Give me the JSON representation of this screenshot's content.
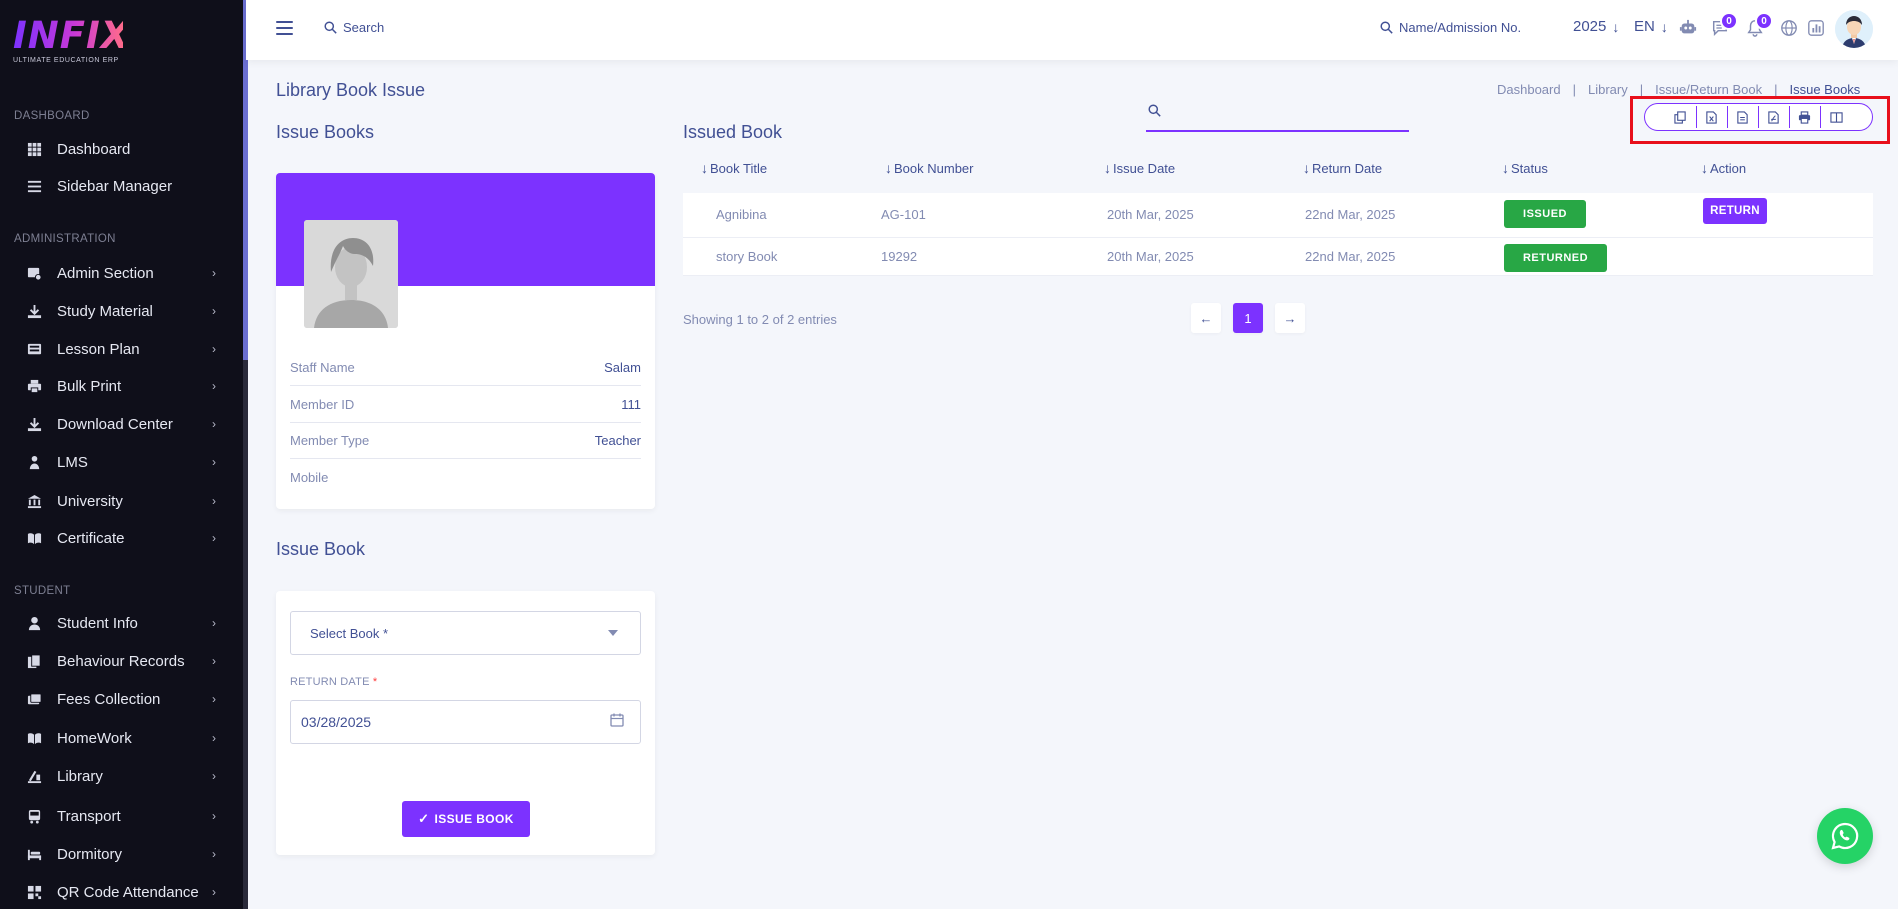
{
  "logo": {
    "word": "INFIX",
    "tagline": "ULTIMATE EDUCATION ERP"
  },
  "sidebar": {
    "sections": [
      {
        "title": "DASHBOARD",
        "items": [
          {
            "label": "Dashboard",
            "icon": "grid-icon"
          },
          {
            "label": "Sidebar Manager",
            "icon": "menu-lines-icon"
          }
        ]
      },
      {
        "title": "ADMINISTRATION",
        "items": [
          {
            "label": "Admin Section",
            "icon": "admin-icon"
          },
          {
            "label": "Study Material",
            "icon": "download-icon"
          },
          {
            "label": "Lesson Plan",
            "icon": "board-icon"
          },
          {
            "label": "Bulk Print",
            "icon": "printer-icon"
          },
          {
            "label": "Download Center",
            "icon": "download-icon"
          },
          {
            "label": "LMS",
            "icon": "lms-icon"
          },
          {
            "label": "University",
            "icon": "institution-icon"
          },
          {
            "label": "Certificate",
            "icon": "book-icon"
          }
        ]
      },
      {
        "title": "STUDENT",
        "items": [
          {
            "label": "Student Info",
            "icon": "user-icon"
          },
          {
            "label": "Behaviour Records",
            "icon": "file-icon"
          },
          {
            "label": "Fees Collection",
            "icon": "money-icon"
          },
          {
            "label": "HomeWork",
            "icon": "book-icon"
          },
          {
            "label": "Library",
            "icon": "library-icon"
          },
          {
            "label": "Transport",
            "icon": "bus-icon"
          },
          {
            "label": "Dormitory",
            "icon": "bed-icon"
          },
          {
            "label": "QR Code Attendance",
            "icon": "qr-icon"
          }
        ]
      }
    ]
  },
  "header": {
    "search_label": "Search",
    "student_search_label": "Name/Admission No.",
    "year": "2025",
    "language": "EN",
    "messages_count": "0",
    "notifications_count": "0"
  },
  "page": {
    "title": "Library Book Issue",
    "breadcrumb": [
      "Dashboard",
      "Library",
      "Issue/Return Book",
      "Issue Books"
    ],
    "issue_books_title": "Issue Books",
    "issue_book_title": "Issue Book",
    "issued_book_title": "Issued Book"
  },
  "profile": {
    "fields": [
      {
        "label": "Staff Name",
        "value": "Salam"
      },
      {
        "label": "Member ID",
        "value": "111"
      },
      {
        "label": "Member Type",
        "value": "Teacher"
      },
      {
        "label": "Mobile",
        "value": ""
      }
    ]
  },
  "form": {
    "select_book_placeholder": "Select Book *",
    "return_date_label": "RETURN DATE",
    "return_date_required": "*",
    "return_date_value": "03/28/2025",
    "submit_label": "ISSUE BOOK"
  },
  "table": {
    "columns": [
      "Book Title",
      "Book Number",
      "Issue Date",
      "Return Date",
      "Status",
      "Action"
    ],
    "rows": [
      {
        "title": "Agnibina",
        "number": "AG-101",
        "issue_date": "20th Mar, 2025",
        "return_date": "22nd Mar, 2025",
        "status": "ISSUED",
        "action": "RETURN"
      },
      {
        "title": "story Book",
        "number": "19292",
        "issue_date": "20th Mar, 2025",
        "return_date": "22nd Mar, 2025",
        "status": "RETURNED",
        "action": ""
      }
    ],
    "entries_text": "Showing 1 to 2 of 2 entries",
    "current_page": "1",
    "export_buttons": [
      "copy-icon",
      "excel-icon",
      "csv-icon",
      "pdf-icon",
      "print-icon",
      "columns-icon"
    ]
  },
  "colors": {
    "accent": "#7c32ff",
    "sidebar_bg": "#0f0f1a",
    "status_green": "#28a745",
    "text": "#415094",
    "highlight_box": "#e8101b",
    "whatsapp": "#25d366"
  }
}
